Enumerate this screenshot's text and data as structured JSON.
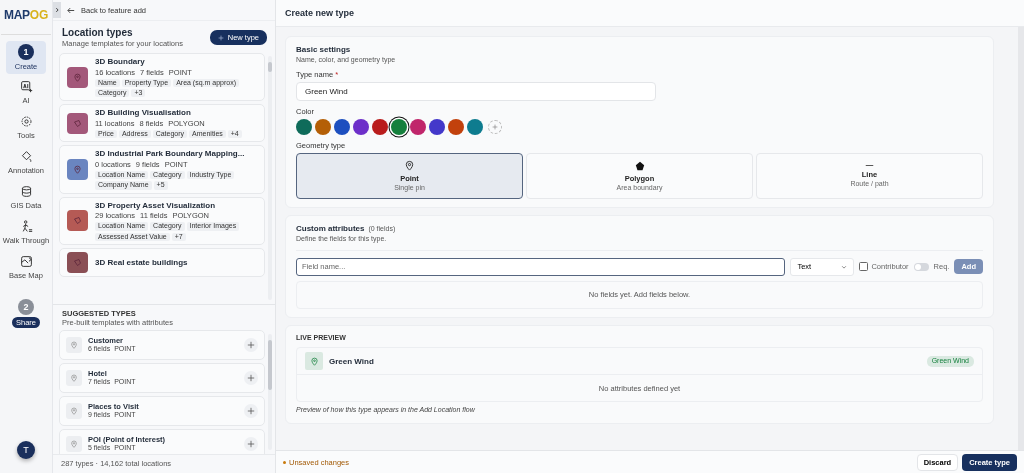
{
  "logo": [
    "MAP",
    "OG"
  ],
  "rail": {
    "items": [
      {
        "kind": "step",
        "number": "1",
        "label": "Create",
        "selected": true
      },
      {
        "kind": "tool",
        "label": "AI"
      },
      {
        "kind": "tool",
        "label": "Tools"
      },
      {
        "kind": "tool",
        "label": "Annotation"
      },
      {
        "kind": "tool",
        "label": "GIS Data"
      },
      {
        "kind": "tool",
        "label": "Walk Through"
      },
      {
        "kind": "tool",
        "label": "Base Map"
      },
      {
        "kind": "step",
        "number": "2",
        "label": "Share",
        "selected": false
      }
    ],
    "avatar": "T"
  },
  "back_link": "Back to feature add",
  "location_types": {
    "title": "Location types",
    "subtitle": "Manage templates for your locations",
    "new_button": "New type",
    "items": [
      {
        "name": "3D Boundary",
        "locations": "16 locations",
        "fields": "7 fields",
        "geometry": "POINT",
        "color": "#a3587a",
        "kind": "point",
        "tags": [
          "Name",
          "Property Type",
          "Area (sq.m approx)",
          "Category",
          "+3"
        ]
      },
      {
        "name": "3D Building Visualisation",
        "locations": "11 locations",
        "fields": "8 fields",
        "geometry": "POLYGON",
        "color": "#a3587a",
        "kind": "polygon",
        "tags": [
          "Price",
          "Address",
          "Category",
          "Amenities",
          "+4"
        ]
      },
      {
        "name": "3D Industrial Park Boundary Mapping...",
        "locations": "0 locations",
        "fields": "9 fields",
        "geometry": "POINT",
        "color": "#6a85c0",
        "kind": "point",
        "tags": [
          "Location Name",
          "Category",
          "Industry Type",
          "Company Name",
          "+5"
        ]
      },
      {
        "name": "3D Property Asset Visualization",
        "locations": "29 locations",
        "fields": "11 fields",
        "geometry": "POLYGON",
        "color": "#b55a55",
        "kind": "polygon",
        "tags": [
          "Location Name",
          "Category",
          "Interior Images",
          "Assessed Asset Value",
          "+7"
        ]
      },
      {
        "name": "3D Real estate buildings",
        "color": "#8a4f55",
        "kind": "polygon"
      }
    ]
  },
  "suggested": {
    "title": "SUGGESTED TYPES",
    "subtitle": "Pre-built templates with attributes",
    "items": [
      {
        "name": "Customer",
        "fields": "6 fields",
        "geometry": "POINT"
      },
      {
        "name": "Hotel",
        "fields": "7 fields",
        "geometry": "POINT"
      },
      {
        "name": "Places to Visit",
        "fields": "9 fields",
        "geometry": "POINT"
      },
      {
        "name": "POI (Point of Interest)",
        "fields": "5 fields",
        "geometry": "POINT"
      }
    ]
  },
  "list_footer": "287 types · 14,162 total locations",
  "main": {
    "title": "Create new type",
    "basic": {
      "title": "Basic settings",
      "subtitle": "Name, color, and geometry type",
      "name_label": "Type name",
      "required_mark": "*",
      "name_value": "Green Wind",
      "color_label": "Color",
      "swatches": [
        {
          "color": "#0f6b5a",
          "selected": false
        },
        {
          "color": "#b45f06",
          "selected": false
        },
        {
          "color": "#1d4fbf",
          "selected": false
        },
        {
          "color": "#6d2fc9",
          "selected": false
        },
        {
          "color": "#b91c1c",
          "selected": false
        },
        {
          "color": "#15803d",
          "selected": true
        },
        {
          "color": "#c0266b",
          "selected": false
        },
        {
          "color": "#4338ca",
          "selected": false
        },
        {
          "color": "#c2410c",
          "selected": false
        },
        {
          "color": "#0e7c8f",
          "selected": false
        }
      ],
      "geometry_label": "Geometry type",
      "geometry_options": [
        {
          "kind": "point",
          "label": "Point",
          "sub": "Single pin",
          "selected": true
        },
        {
          "kind": "polygon",
          "label": "Polygon",
          "sub": "Area boundary",
          "selected": false
        },
        {
          "kind": "line",
          "label": "Line",
          "sub": "Route / path",
          "selected": false
        }
      ]
    },
    "custom": {
      "title": "Custom attributes",
      "count": "(0 fields)",
      "subtitle": "Define the fields for this type.",
      "field_placeholder": "Field name...",
      "type_value": "Text",
      "contributor": {
        "label": "Contributor",
        "checked": false
      },
      "required": {
        "label": "Req.",
        "on": false
      },
      "add_button": {
        "label": "Add",
        "disabled": true
      },
      "empty": "No fields yet. Add fields below."
    },
    "preview": {
      "title": "LIVE PREVIEW",
      "name": "Green Wind",
      "badge": "Green Wind",
      "empty": "No attributes defined yet",
      "note": "Preview of how this type appears in the Add Location flow"
    },
    "footer": {
      "status": "Unsaved changes",
      "discard": "Discard",
      "create": "Create type"
    }
  }
}
